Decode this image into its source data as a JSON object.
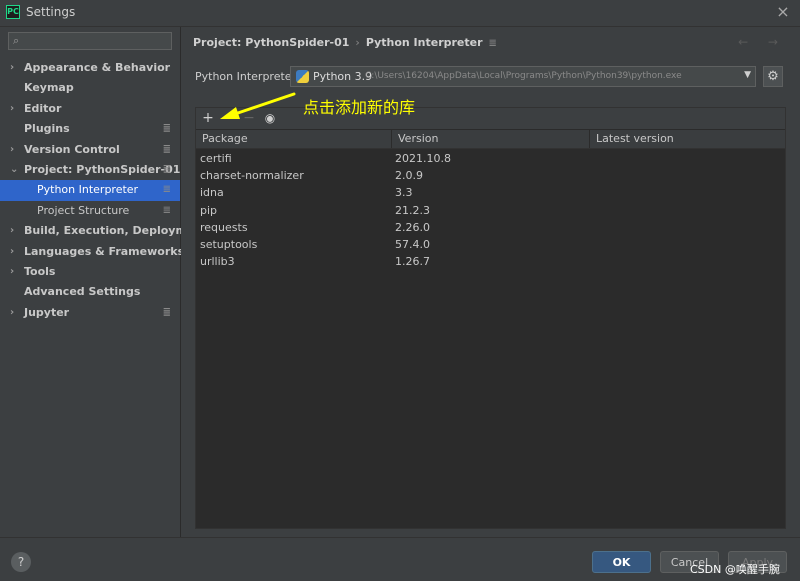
{
  "window": {
    "title": "Settings",
    "logo": "PC",
    "close_icon": "×"
  },
  "sidebar": {
    "search_icon": "⌕",
    "search_value": "",
    "items": [
      {
        "label": "Appearance & Behavior",
        "arrow": "›",
        "mark": "",
        "type": "top",
        "selected": false
      },
      {
        "label": "Keymap",
        "arrow": "",
        "mark": "",
        "type": "top",
        "selected": false
      },
      {
        "label": "Editor",
        "arrow": "›",
        "mark": "",
        "type": "top",
        "selected": false
      },
      {
        "label": "Plugins",
        "arrow": "",
        "mark": "≣",
        "type": "top",
        "selected": false
      },
      {
        "label": "Version Control",
        "arrow": "›",
        "mark": "≣",
        "type": "top",
        "selected": false
      },
      {
        "label": "Project: PythonSpider-01",
        "arrow": "⌄",
        "mark": "≣",
        "type": "top",
        "selected": false
      },
      {
        "label": "Python Interpreter",
        "arrow": "",
        "mark": "≣",
        "type": "sub",
        "selected": true
      },
      {
        "label": "Project Structure",
        "arrow": "",
        "mark": "≣",
        "type": "sub",
        "selected": false
      },
      {
        "label": "Build, Execution, Deployment",
        "arrow": "›",
        "mark": "",
        "type": "top",
        "selected": false
      },
      {
        "label": "Languages & Frameworks",
        "arrow": "›",
        "mark": "",
        "type": "top",
        "selected": false
      },
      {
        "label": "Tools",
        "arrow": "›",
        "mark": "",
        "type": "top",
        "selected": false
      },
      {
        "label": "Advanced Settings",
        "arrow": "",
        "mark": "",
        "type": "top",
        "selected": false
      },
      {
        "label": "Jupyter",
        "arrow": "›",
        "mark": "≣",
        "type": "top",
        "selected": false
      }
    ]
  },
  "main": {
    "breadcrumb": {
      "project": "Project: PythonSpider-01",
      "separator": "›",
      "page": "Python Interpreter",
      "mark": "≣"
    },
    "nav_arrows": "← →",
    "interpreter": {
      "label": "Python Interpreter:",
      "name": "Python 3.9",
      "path": "C:\\Users\\16204\\AppData\\Local\\Programs\\Python\\Python39\\python.exe",
      "dropdown_icon": "▼",
      "gear_icon": "⚙"
    },
    "toolbar": {
      "add_icon": "+",
      "remove_icon": "−",
      "eye_icon": "◉"
    },
    "table": {
      "headers": {
        "package": "Package",
        "version": "Version",
        "latest": "Latest version"
      },
      "rows": [
        {
          "package": "certifi",
          "version": "2021.10.8",
          "latest": ""
        },
        {
          "package": "charset-normalizer",
          "version": "2.0.9",
          "latest": ""
        },
        {
          "package": "idna",
          "version": "3.3",
          "latest": ""
        },
        {
          "package": "pip",
          "version": "21.2.3",
          "latest": ""
        },
        {
          "package": "requests",
          "version": "2.26.0",
          "latest": ""
        },
        {
          "package": "setuptools",
          "version": "57.4.0",
          "latest": ""
        },
        {
          "package": "urllib3",
          "version": "1.26.7",
          "latest": ""
        }
      ]
    }
  },
  "annotation": {
    "text": "点击添加新的库",
    "color": "#ffff00"
  },
  "footer": {
    "help_icon": "?",
    "ok_label": "OK",
    "cancel_label": "Cancel",
    "apply_label": "Apply",
    "watermark": "CSDN @唤醒手腕"
  }
}
